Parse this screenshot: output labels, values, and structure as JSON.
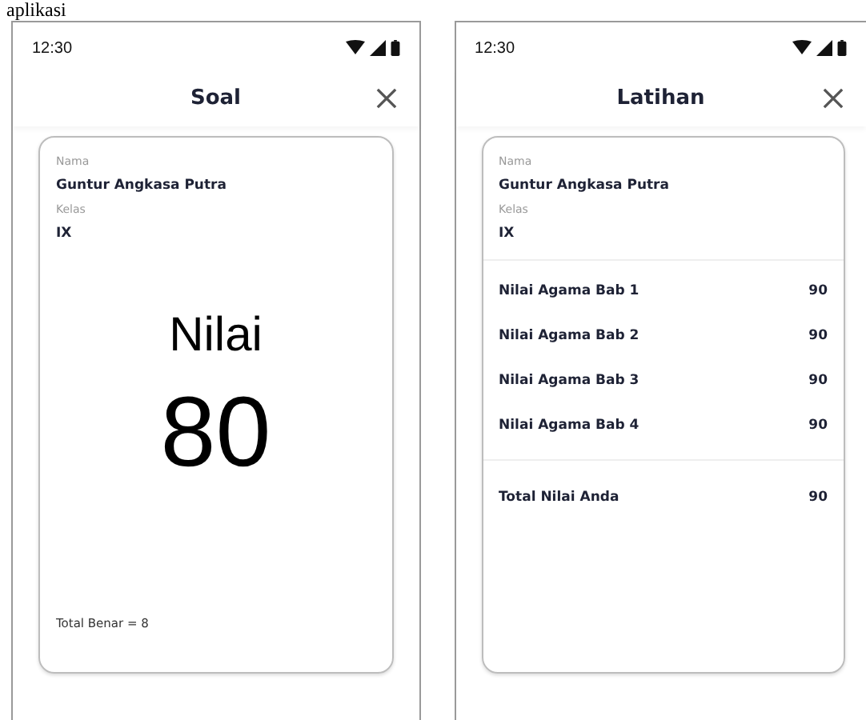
{
  "caption": "aplikasi",
  "screens": [
    {
      "kind": "score",
      "status_time": "12:30",
      "title": "Soal",
      "name_label": "Nama",
      "name": "Guntur Angkasa Putra",
      "class_label": "Kelas",
      "class": "IX",
      "score_label": "Nilai",
      "score": "80",
      "footer": "Total Benar = 8"
    },
    {
      "kind": "list",
      "status_time": "12:30",
      "title": "Latihan",
      "name_label": "Nama",
      "name": "Guntur Angkasa Putra",
      "class_label": "Kelas",
      "class": "IX",
      "rows": [
        {
          "label": "Nilai Agama Bab 1",
          "value": "90"
        },
        {
          "label": "Nilai Agama Bab 2",
          "value": "90"
        },
        {
          "label": "Nilai Agama Bab 3",
          "value": "90"
        },
        {
          "label": "Nilai Agama Bab 4",
          "value": "90"
        }
      ],
      "total": {
        "label": "Total Nilai Anda",
        "value": "90"
      }
    }
  ]
}
